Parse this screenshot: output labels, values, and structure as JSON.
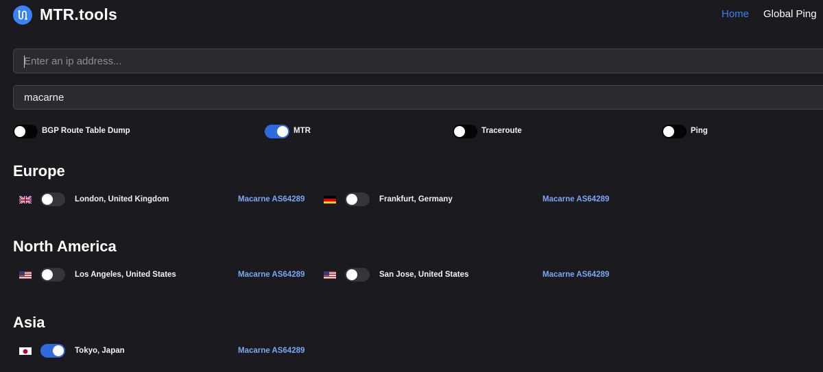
{
  "header": {
    "brand": "MTR.tools",
    "nav": [
      {
        "label": "Home",
        "active": true
      },
      {
        "label": "Global Ping",
        "active": false
      }
    ]
  },
  "search": {
    "placeholder": "Enter an ip address...",
    "value": ""
  },
  "provider_select": {
    "value": "macarne"
  },
  "options": [
    {
      "label": "BGP Route Table Dump",
      "enabled": false
    },
    {
      "label": "MTR",
      "enabled": true
    },
    {
      "label": "Traceroute",
      "enabled": false
    },
    {
      "label": "Ping",
      "enabled": false
    }
  ],
  "regions": [
    {
      "title": "Europe",
      "locations": [
        {
          "flag": "uk-flag-icon",
          "name": "London, United Kingdom",
          "provider": "Macarne AS64289",
          "enabled": false
        },
        {
          "flag": "germany-flag-icon",
          "name": "Frankfurt, Germany",
          "provider": "Macarne AS64289",
          "enabled": false
        }
      ]
    },
    {
      "title": "North America",
      "locations": [
        {
          "flag": "us-flag-icon",
          "name": "Los Angeles, United States",
          "provider": "Macarne AS64289",
          "enabled": false
        },
        {
          "flag": "us-flag-icon",
          "name": "San Jose, United States",
          "provider": "Macarne AS64289",
          "enabled": false
        }
      ]
    },
    {
      "title": "Asia",
      "locations": [
        {
          "flag": "japan-flag-icon",
          "name": "Tokyo, Japan",
          "provider": "Macarne AS64289",
          "enabled": true
        }
      ]
    }
  ],
  "colors": {
    "background": "#1b1b1f",
    "accent": "#3b82f6",
    "link": "#7aa6f5",
    "input_bg": "#2a2b2f"
  }
}
